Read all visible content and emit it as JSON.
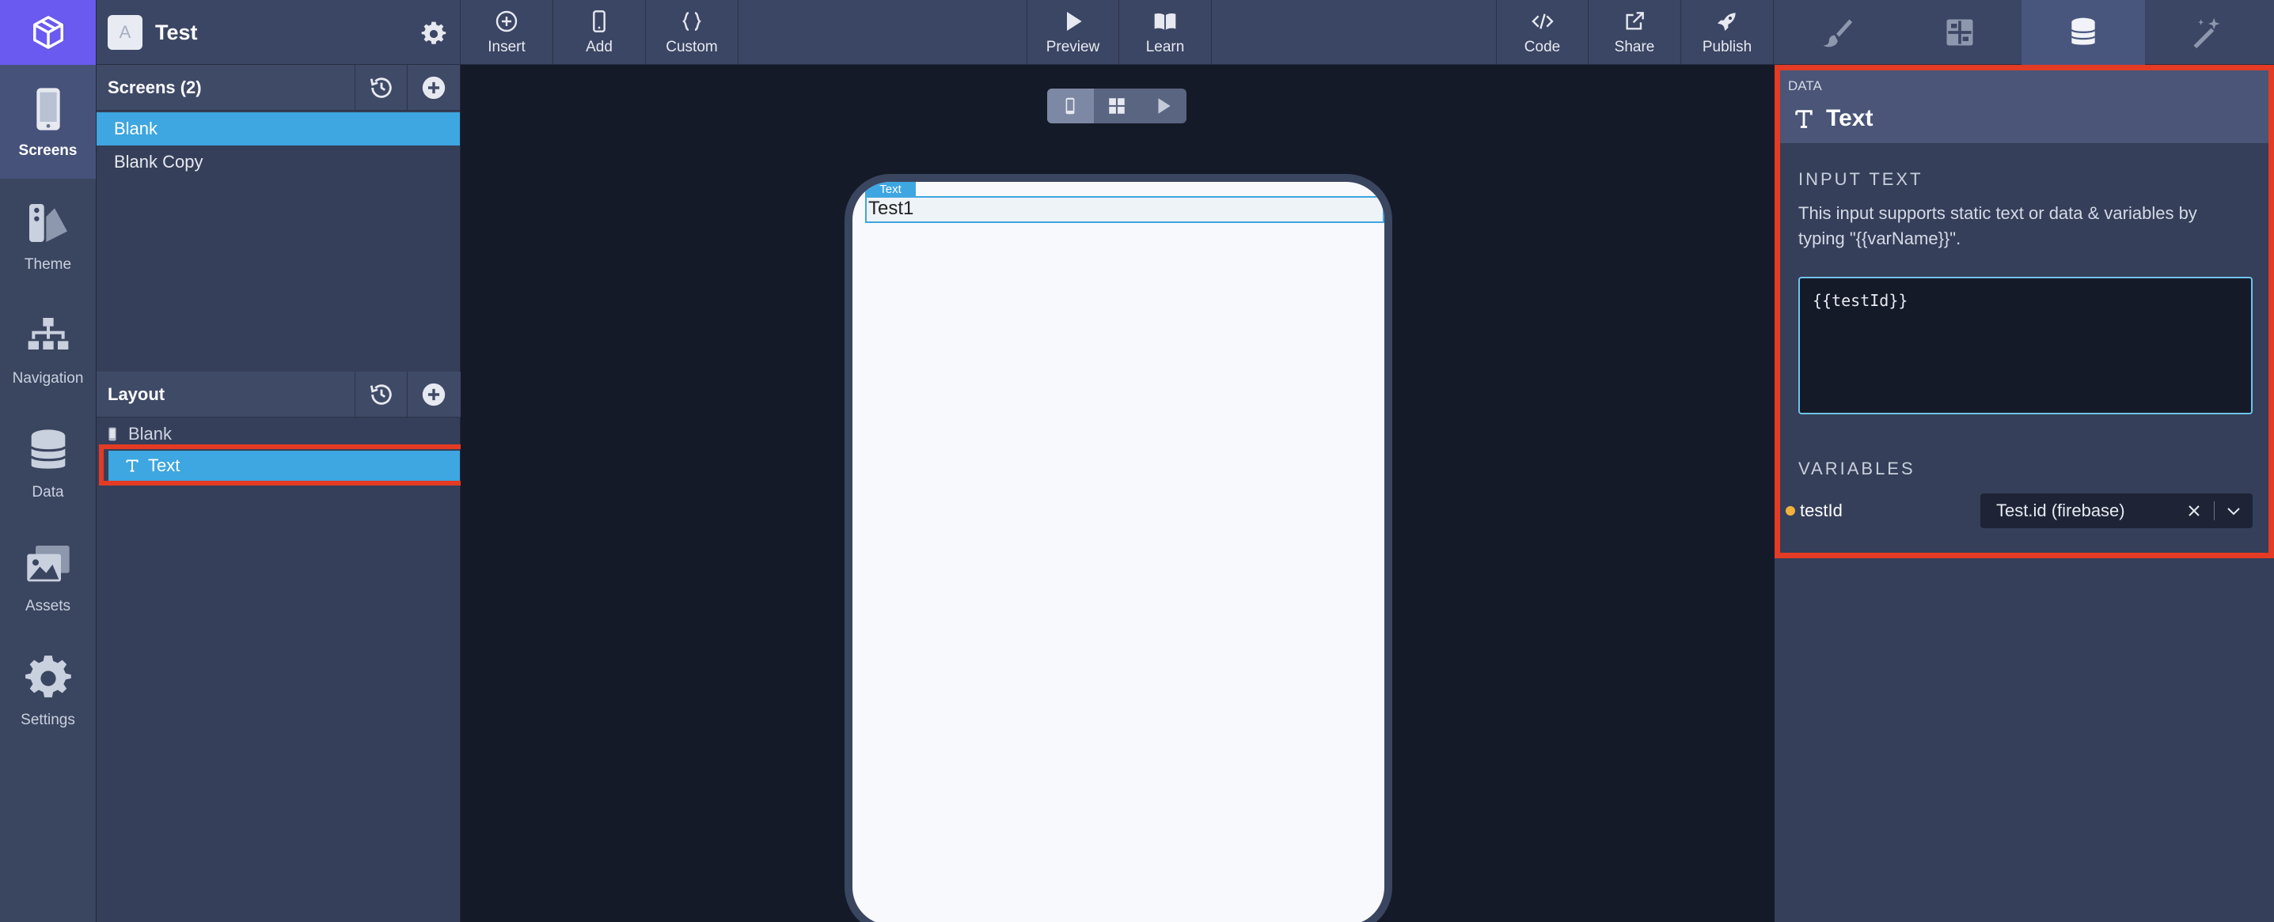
{
  "rail": {
    "items": [
      {
        "label": "Screens",
        "active": true
      },
      {
        "label": "Theme"
      },
      {
        "label": "Navigation"
      },
      {
        "label": "Data"
      },
      {
        "label": "Assets"
      },
      {
        "label": "Settings"
      }
    ]
  },
  "app": {
    "avatar_letter": "A",
    "name": "Test"
  },
  "toolbar": {
    "insert": "Insert",
    "add": "Add",
    "custom": "Custom",
    "preview": "Preview",
    "learn": "Learn",
    "code": "Code",
    "share": "Share",
    "publish": "Publish"
  },
  "screens": {
    "title": "Screens (2)",
    "items": [
      "Blank",
      "Blank Copy"
    ],
    "selected": "Blank"
  },
  "layout": {
    "title": "Layout",
    "root": "Blank",
    "child": "Text"
  },
  "canvas": {
    "element_tag": "Text",
    "element_value": "Test1"
  },
  "props": {
    "kicker": "DATA",
    "title": "Text",
    "input_section": "INPUT TEXT",
    "help": "This input supports static text or data & variables by typing \"{{varName}}\".",
    "input_value": "{{testId}}",
    "variables_section": "VARIABLES",
    "variable_name": "testId",
    "variable_value": "Test.id (firebase)"
  },
  "colors": {
    "accent": "#3ea6e0",
    "brand": "#6a5af0",
    "highlight": "#e33b24",
    "variable_dot": "#f3b13c"
  }
}
